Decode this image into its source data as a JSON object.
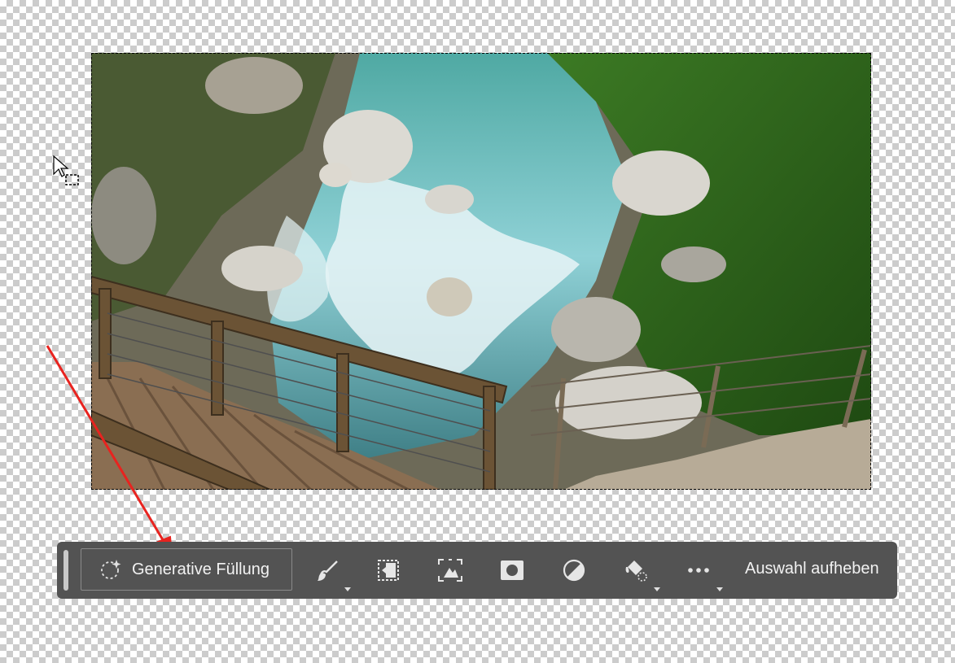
{
  "canvas": {
    "image_subject": "mountain river with rocks and wooden bridge",
    "colors": {
      "checker_light": "#ffffff",
      "checker_dark": "#cccccc",
      "annotation_arrow": "#e8231f",
      "taskbar_bg": "#535353"
    }
  },
  "contextual_taskbar": {
    "generative_fill_label": "Generative Füllung",
    "tools": [
      {
        "name": "brush-icon",
        "has_dropdown": true
      },
      {
        "name": "transform-selection-icon",
        "has_dropdown": false
      },
      {
        "name": "select-subject-icon",
        "has_dropdown": false
      },
      {
        "name": "mask-icon",
        "has_dropdown": false
      },
      {
        "name": "adjustment-icon",
        "has_dropdown": false
      },
      {
        "name": "fill-bucket-icon",
        "has_dropdown": true
      },
      {
        "name": "more-options-icon",
        "has_dropdown": true
      }
    ],
    "deselect_label": "Auswahl aufheben"
  }
}
